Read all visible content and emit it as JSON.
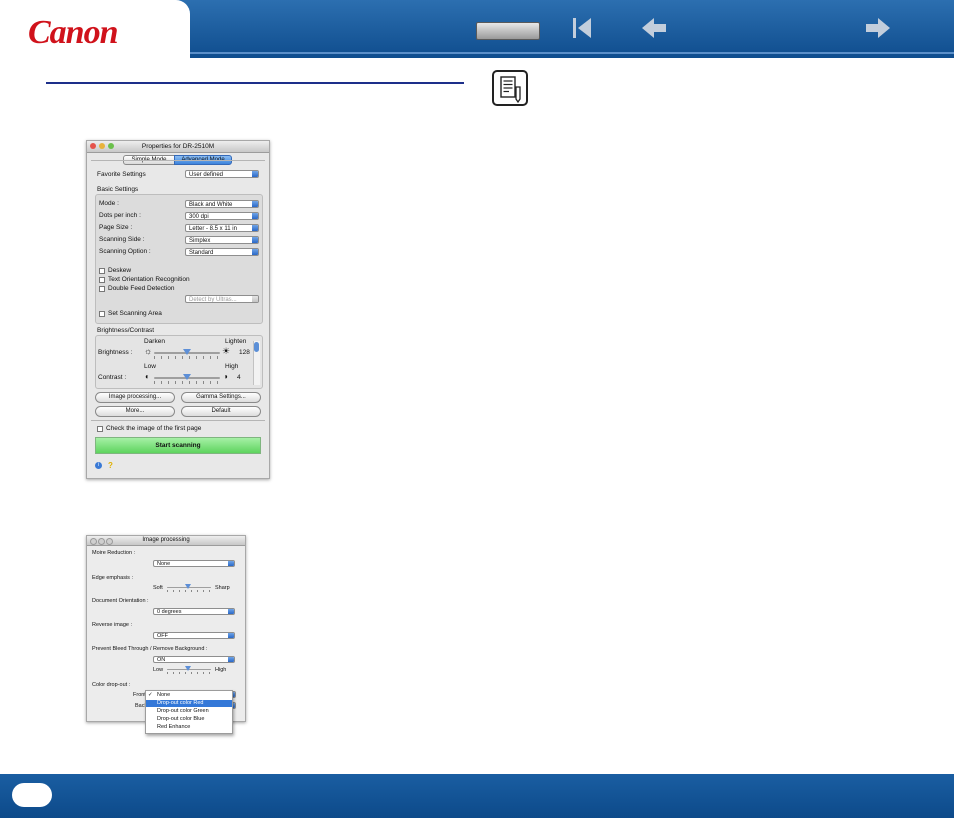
{
  "header": {
    "logo_text": "Canon",
    "nav_icons": [
      "home-button",
      "first-page-icon",
      "previous-page-icon",
      "next-page-icon"
    ]
  },
  "note_icon": "note-icon",
  "properties_window": {
    "title": "Properties for DR-2510M",
    "tabs": [
      "Simple Mode",
      "Advanced Mode"
    ],
    "favorite_label": "Favorite Settings",
    "favorite_value": "User defined",
    "basic_settings_title": "Basic Settings",
    "rows": [
      {
        "label": "Mode :",
        "value": "Black and White"
      },
      {
        "label": "Dots per inch :",
        "value": "300 dpi"
      },
      {
        "label": "Page Size :",
        "value": "Letter - 8.5 x 11 in"
      },
      {
        "label": "Scanning Side :",
        "value": "Simplex"
      },
      {
        "label": "Scanning Option :",
        "value": "Standard"
      }
    ],
    "deskew": "Deskew",
    "text_orientation": "Text Orientation Recognition",
    "double_feed": "Double Feed Detection",
    "detect_by": "Detect by Ultras...",
    "set_scanning_area": "Set Scanning Area",
    "brightness_contrast_title": "Brightness/Contrast",
    "brightness": {
      "label": "Brightness :",
      "low": "Darken",
      "high": "Lighten",
      "value": "128"
    },
    "contrast": {
      "label": "Contrast :",
      "low": "Low",
      "high": "High",
      "value": "4"
    },
    "image_processing_btn": "Image processing...",
    "gamma_btn": "Gamma Settings...",
    "more_btn": "More...",
    "default_btn": "Default",
    "check_first_page": "Check the image of the first page",
    "start_scanning": "Start scanning",
    "footer_icons": [
      "info-icon",
      "help-icon"
    ]
  },
  "image_processing_window": {
    "title": "Image processing",
    "moire_label": "Moire Reduction :",
    "moire_value": "None",
    "edge_label": "Edge emphasis :",
    "edge_low": "Soft",
    "edge_high": "Sharp",
    "orientation_label": "Document Orientation :",
    "orientation_value": "0 degrees",
    "reverse_label": "Reverse image :",
    "reverse_value": "OFF",
    "bleed_label": "Prevent Bleed Through / Remove Background :",
    "bleed_value": "ON",
    "bleed_low": "Low",
    "bleed_high": "High",
    "dropout_label": "Color drop-out :",
    "front_label": "Front",
    "back_label": "Back",
    "menu": [
      "None",
      "Drop-out color Red",
      "Drop-out color Green",
      "Drop-out color Blue",
      "Red Enhance"
    ],
    "menu_checked": "None",
    "menu_highlighted": "Drop-out color Red"
  },
  "colors": {
    "header_blue": "#1a5ea2",
    "logo_red": "#d0121b",
    "start_green": "#7be37b",
    "highlight_blue": "#3478d8"
  }
}
